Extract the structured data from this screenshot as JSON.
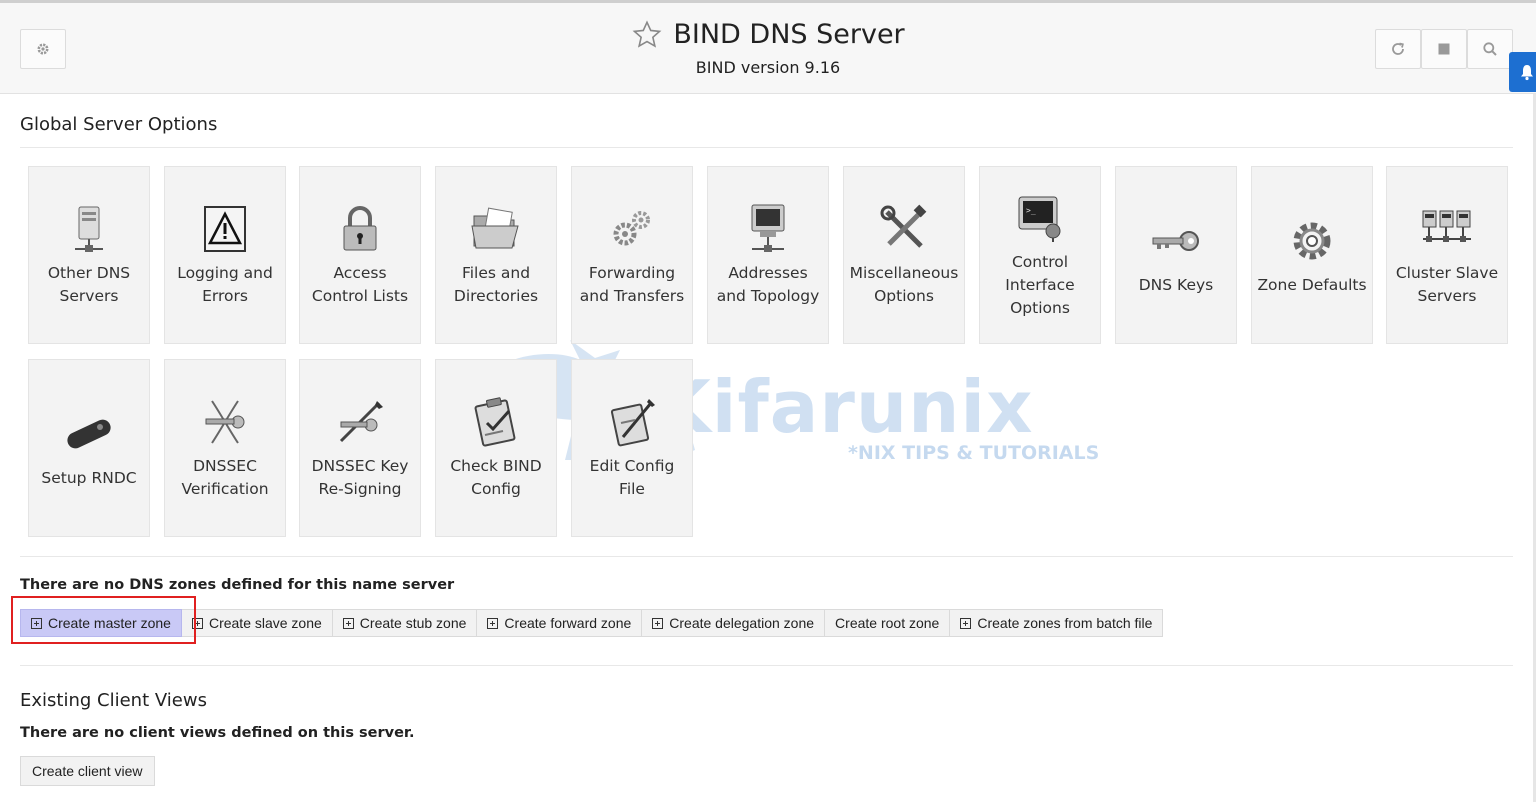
{
  "header": {
    "title": "BIND DNS Server",
    "subtitle": "BIND version 9.16"
  },
  "global_options": {
    "title": "Global Server Options",
    "tiles": [
      {
        "label": "Other DNS Servers",
        "icon": "server-icon"
      },
      {
        "label": "Logging and Errors",
        "icon": "warning-icon"
      },
      {
        "label": "Access Control Lists",
        "icon": "lock-icon"
      },
      {
        "label": "Files and Directories",
        "icon": "folder-icon"
      },
      {
        "label": "Forwarding and Transfers",
        "icon": "gears-icon"
      },
      {
        "label": "Addresses and Topology",
        "icon": "monitor-network-icon"
      },
      {
        "label": "Miscellaneous Options",
        "icon": "tools-icon"
      },
      {
        "label": "Control Interface Options",
        "icon": "terminal-plug-icon"
      },
      {
        "label": "DNS Keys",
        "icon": "key-icon"
      },
      {
        "label": "Zone Defaults",
        "icon": "cog-icon"
      },
      {
        "label": "Cluster Slave Servers",
        "icon": "cluster-icon"
      },
      {
        "label": "Setup RNDC",
        "icon": "remote-control-icon"
      },
      {
        "label": "DNSSEC Verification",
        "icon": "dnssec-verify-icon"
      },
      {
        "label": "DNSSEC Key Re-Signing",
        "icon": "pen-key-icon"
      },
      {
        "label": "Check BIND Config",
        "icon": "clipboard-check-icon"
      },
      {
        "label": "Edit Config File",
        "icon": "edit-config-icon"
      }
    ]
  },
  "zones": {
    "empty_message": "There are no DNS zones defined for this name server",
    "buttons": [
      {
        "label": "Create master zone",
        "icon": "plus-box-icon",
        "active": true
      },
      {
        "label": "Create slave zone",
        "icon": "plus-box-icon"
      },
      {
        "label": "Create stub zone",
        "icon": "plus-box-icon"
      },
      {
        "label": "Create forward zone",
        "icon": "plus-box-icon"
      },
      {
        "label": "Create delegation zone",
        "icon": "plus-box-icon"
      },
      {
        "label": "Create root zone",
        "icon": ""
      },
      {
        "label": "Create zones from batch file",
        "icon": "plus-box-icon"
      }
    ]
  },
  "client_views": {
    "title": "Existing Client Views",
    "empty_message": "There are no client views defined on this server.",
    "create_label": "Create client view"
  },
  "watermark": {
    "brand": "Kifarunix",
    "tagline": "*NIX TIPS & TUTORIALS"
  },
  "colors": {
    "highlight_border": "#e02020",
    "active_button": "#c9c9f6",
    "notify_tab": "#1d6fd1"
  }
}
